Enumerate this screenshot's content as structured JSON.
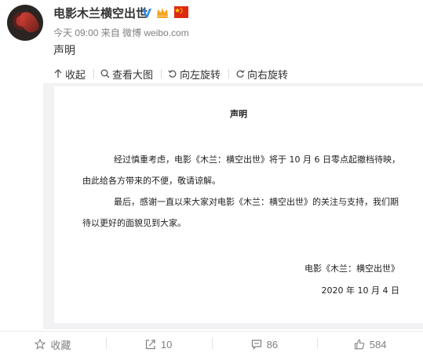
{
  "post": {
    "username": "电影木兰横空出世",
    "meta": "今天 09:00 来自 微博 weibo.com",
    "text": "声明"
  },
  "media_toolbar": {
    "collapse": "收起",
    "view_large": "查看大图",
    "rotate_left": "向左旋转",
    "rotate_right": "向右旋转"
  },
  "document": {
    "title": "声明",
    "para1": "经过慎重考虑，电影《木兰：横空出世》将于 10 月 6 日零点起撤档待映，由此给各方带来的不便，敬请谅解。",
    "para2": "最后，感谢一直以来大家对电影《木兰：横空出世》的关注与支持，我们期待以更好的面貌见到大家。",
    "signature": "电影《木兰：横空出世》",
    "date": "2020 年 10 月 4 日"
  },
  "actions": {
    "favorite": "收藏",
    "repost": "10",
    "comment": "86",
    "like": "584"
  },
  "colors": {
    "link": "#333333",
    "muted": "#808080",
    "verified": "#2f8fe3",
    "vip": "#f6a623",
    "flag": "#de2910"
  }
}
